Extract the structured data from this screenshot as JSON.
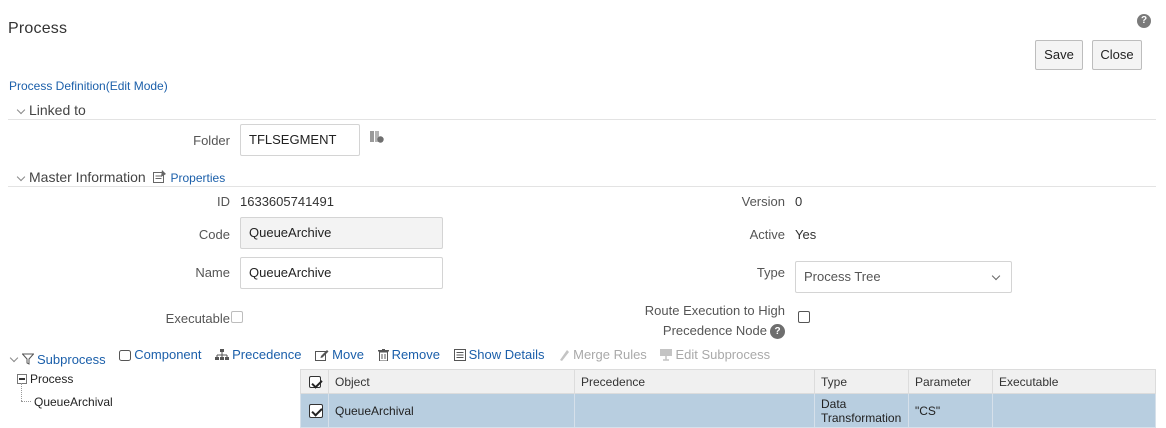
{
  "header": {
    "title": "Process",
    "help_icon": "?",
    "save_label": "Save",
    "close_label": "Close"
  },
  "mode_link": "Process Definition(Edit Mode)",
  "linked_to": {
    "title": "Linked to",
    "folder_label": "Folder",
    "folder_value": "TFLSEGMENT"
  },
  "master": {
    "title": "Master Information",
    "properties_label": "Properties",
    "id_label": "ID",
    "id_value": "1633605741491",
    "version_label": "Version",
    "version_value": "0",
    "code_label": "Code",
    "code_value": "QueueArchive",
    "active_label": "Active",
    "active_value": "Yes",
    "name_label": "Name",
    "name_value": "QueueArchive",
    "type_label": "Type",
    "type_value": "Process Tree",
    "executable_label": "Executable",
    "route_label_1": "Route Execution to High",
    "route_label_2": "Precedence Node"
  },
  "toolbar": {
    "subprocess": "Subprocess",
    "component": "Component",
    "precedence": "Precedence",
    "move": "Move",
    "remove": "Remove",
    "show_details": "Show Details",
    "merge_rules": "Merge Rules",
    "edit_subprocess": "Edit Subprocess"
  },
  "tree": {
    "root": "Process",
    "child": "QueueArchival"
  },
  "grid": {
    "columns": [
      "Object",
      "Precedence",
      "Type",
      "Parameter",
      "Executable"
    ],
    "rows": [
      {
        "object": "QueueArchival",
        "precedence": "",
        "type_line1": "Data",
        "type_line2": "Transformation",
        "parameter": "\"CS\"",
        "executable": ""
      }
    ]
  },
  "colors": {
    "link": "#1b5faa",
    "selected_row": "#b8cee0"
  }
}
